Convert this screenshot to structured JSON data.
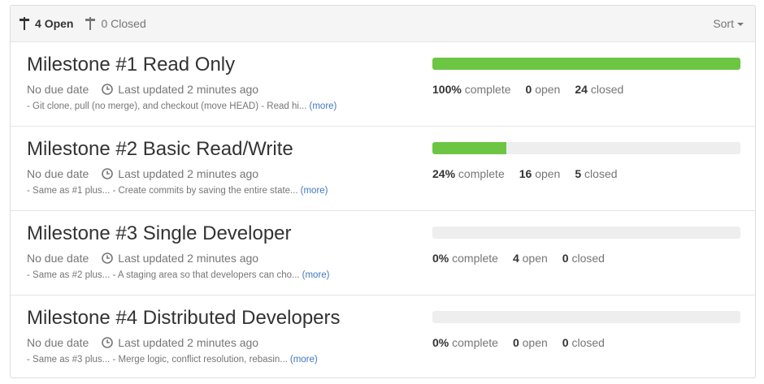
{
  "header": {
    "open_count": "4",
    "open_label": "Open",
    "closed_count": "0",
    "closed_label": "Closed",
    "sort_label": "Sort"
  },
  "colors": {
    "progress_fill": "#6cc644",
    "progress_track": "#eeeeee",
    "link": "#4078c0",
    "muted": "#767676"
  },
  "milestones": [
    {
      "title": "Milestone #1 Read Only",
      "due": "No due date",
      "updated": "Last updated 2 minutes ago",
      "description": "- Git clone, pull (no merge), and checkout (move HEAD) - Read hi...",
      "more": "(more)",
      "progress": 1.0,
      "percent": "100%",
      "complete_label": "complete",
      "open": "0",
      "open_label": "open",
      "closed": "24",
      "closed_label": "closed"
    },
    {
      "title": "Milestone #2 Basic Read/Write",
      "due": "No due date",
      "updated": "Last updated 2 minutes ago",
      "description": "- Same as #1 plus... - Create commits by saving the entire state...",
      "more": "(more)",
      "progress": 0.24,
      "percent": "24%",
      "complete_label": "complete",
      "open": "16",
      "open_label": "open",
      "closed": "5",
      "closed_label": "closed"
    },
    {
      "title": "Milestone #3 Single Developer",
      "due": "No due date",
      "updated": "Last updated 2 minutes ago",
      "description": "- Same as #2 plus... - A staging area so that developers can cho...",
      "more": "(more)",
      "progress": 0.0,
      "percent": "0%",
      "complete_label": "complete",
      "open": "4",
      "open_label": "open",
      "closed": "0",
      "closed_label": "closed"
    },
    {
      "title": "Milestone #4 Distributed Developers",
      "due": "No due date",
      "updated": "Last updated 2 minutes ago",
      "description": "- Same as #3 plus... - Merge logic, conflict resolution, rebasin...",
      "more": "(more)",
      "progress": 0.0,
      "percent": "0%",
      "complete_label": "complete",
      "open": "0",
      "open_label": "open",
      "closed": "0",
      "closed_label": "closed"
    }
  ]
}
